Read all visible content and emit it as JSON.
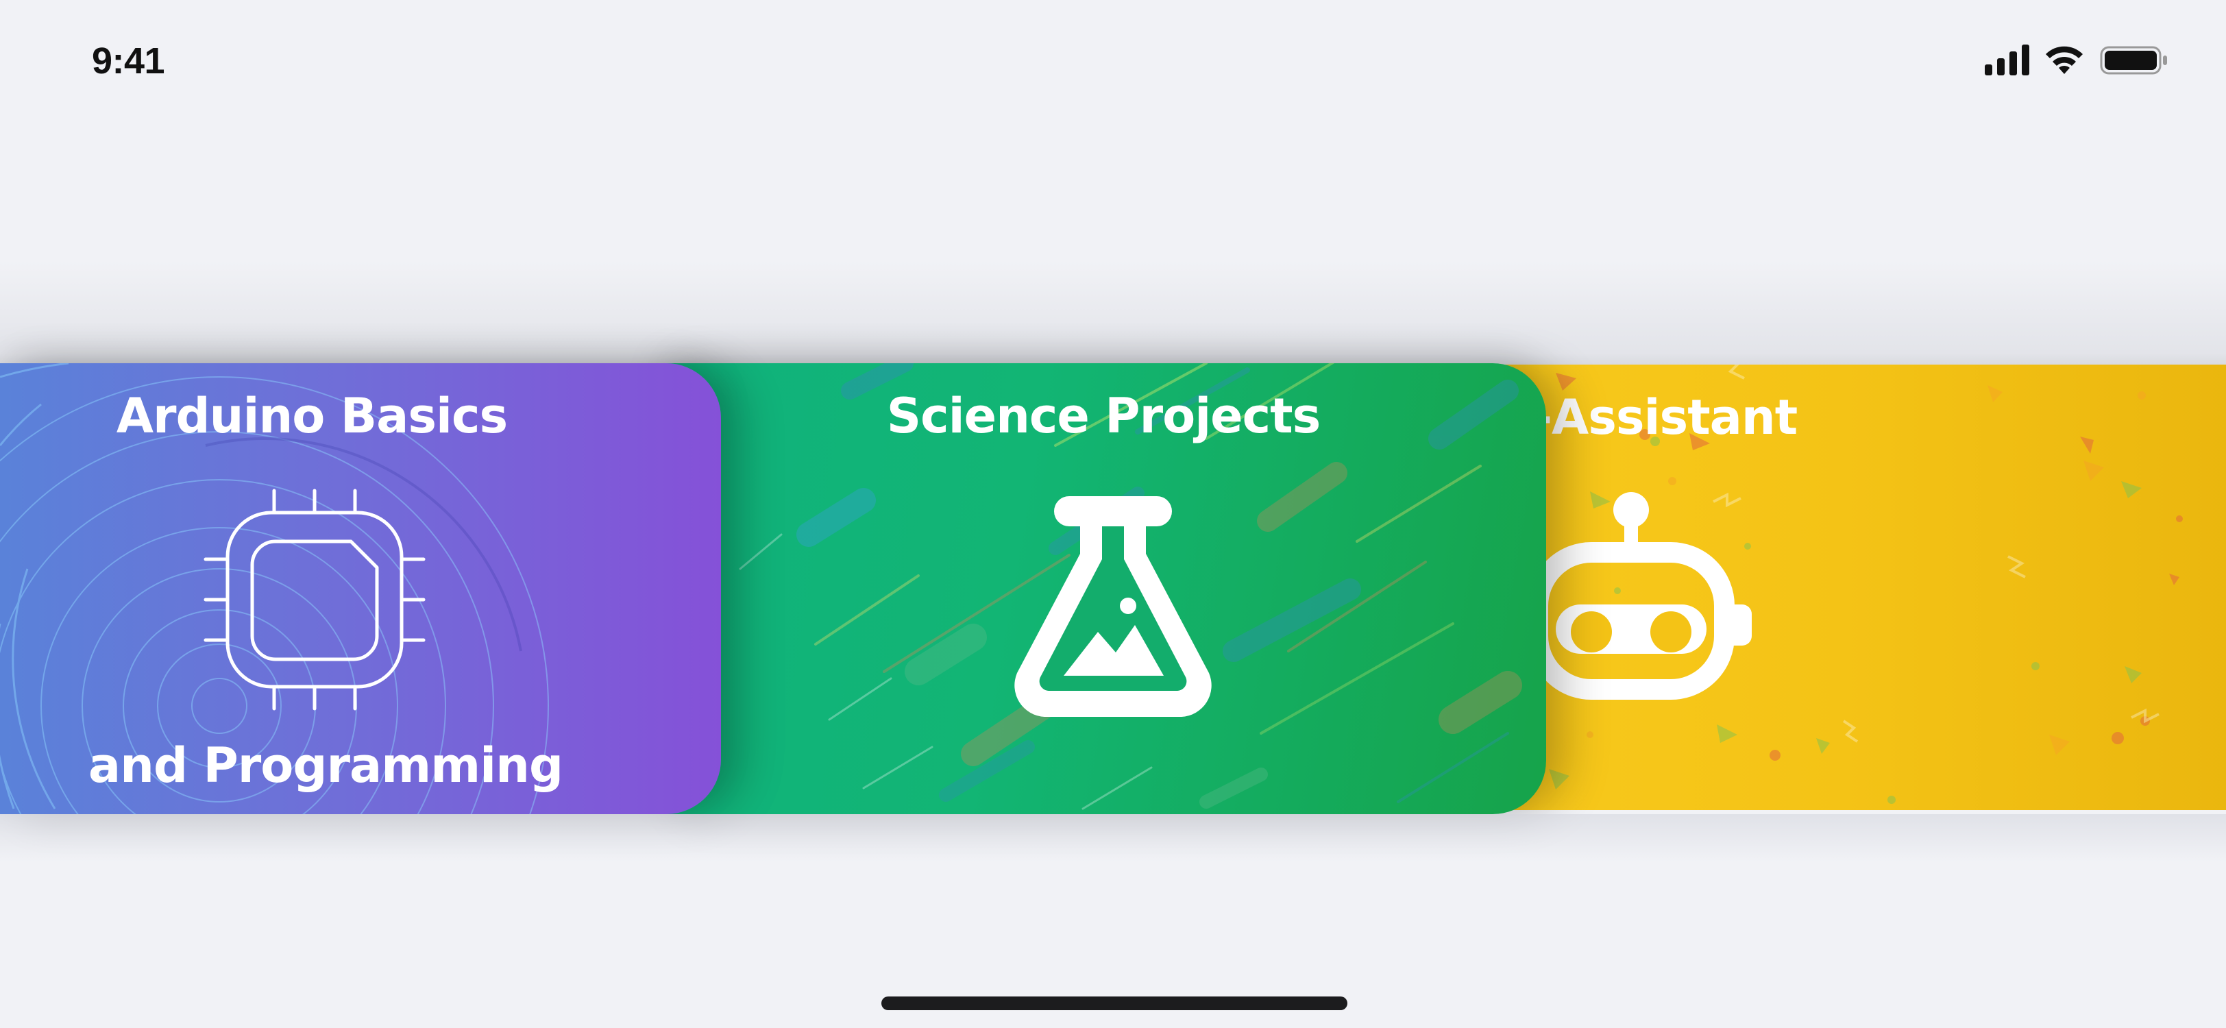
{
  "status_bar": {
    "time": "9:41",
    "icons": [
      "cellular-signal-icon",
      "wifi-icon",
      "battery-icon"
    ]
  },
  "carousel": {
    "cards": [
      {
        "title_line1": "Arduino Basics",
        "title_line2": "and Programming",
        "icon": "microchip-icon",
        "color_start": "#5a82d9",
        "color_end": "#8551d8"
      },
      {
        "title": "Science Projects",
        "icon": "flask-icon",
        "color_start": "#10b27d",
        "color_end": "#16a34a"
      },
      {
        "title": "AI-Assistant",
        "icon": "robot-icon",
        "color_start": "#f7c81b",
        "color_end": "#eab60e"
      }
    ]
  },
  "home_indicator": {
    "color": "#1c1c1e"
  }
}
